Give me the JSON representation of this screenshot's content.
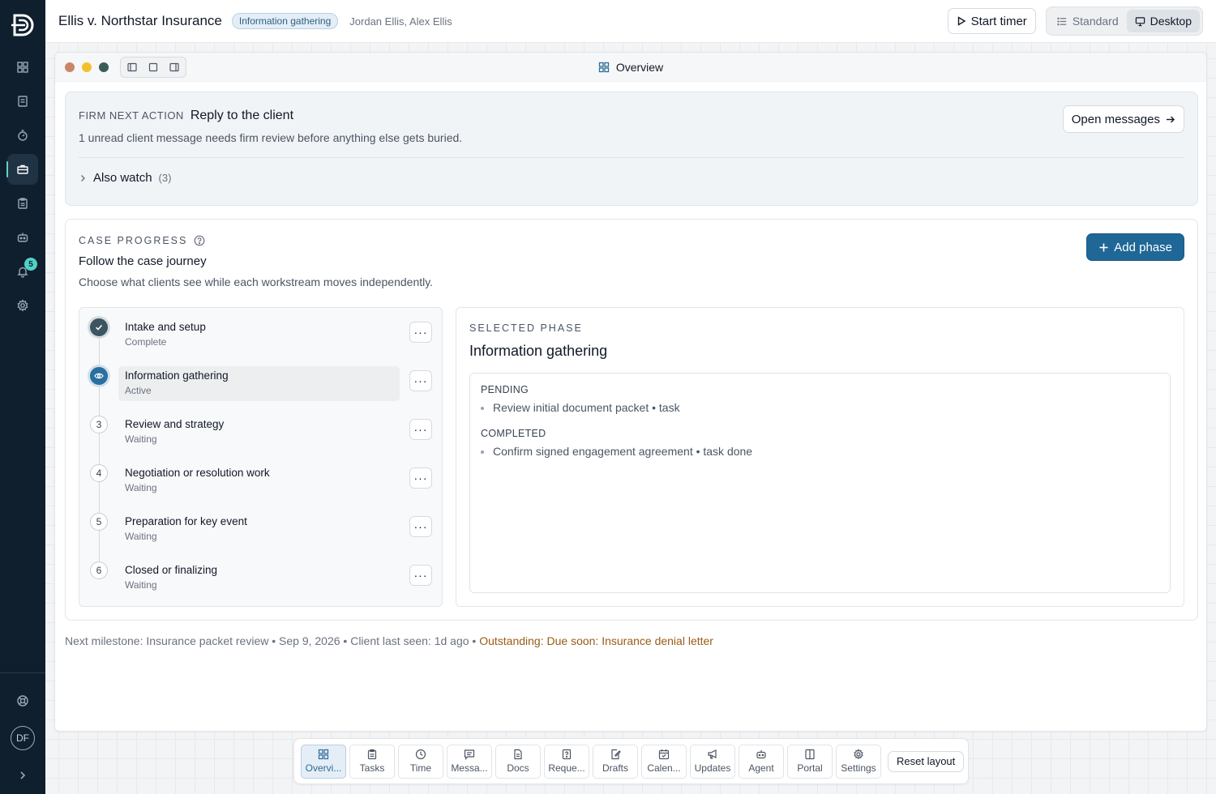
{
  "topbar": {
    "case_title": "Ellis v. Northstar Insurance",
    "phase_pill": "Information gathering",
    "clients": "Jordan Ellis, Alex Ellis",
    "start_timer": "Start timer",
    "view_standard": "Standard",
    "view_desktop": "Desktop"
  },
  "rail": {
    "notifications_badge": "5",
    "avatar_initials": "DF"
  },
  "window": {
    "title": "Overview",
    "dot_colors": [
      "#c9866a",
      "#f3c02d",
      "#3b5d58"
    ]
  },
  "next_action": {
    "eyebrow": "Firm next action",
    "headline": "Reply to the client",
    "description": "1 unread client message needs firm review before anything else gets buried.",
    "open_button": "Open messages",
    "also_watch_label": "Also watch",
    "also_watch_count": "(3)"
  },
  "progress": {
    "eyebrow": "Case progress",
    "title": "Follow the case journey",
    "subtitle": "Choose what clients see while each workstream moves independently.",
    "add_phase": "Add phase",
    "phases": [
      {
        "marker": "",
        "name": "Intake and setup",
        "status": "Complete"
      },
      {
        "marker": "",
        "name": "Information gathering",
        "status": "Active"
      },
      {
        "marker": "3",
        "name": "Review and strategy",
        "status": "Waiting"
      },
      {
        "marker": "4",
        "name": "Negotiation or resolution work",
        "status": "Waiting"
      },
      {
        "marker": "5",
        "name": "Preparation for key event",
        "status": "Waiting"
      },
      {
        "marker": "6",
        "name": "Closed or finalizing",
        "status": "Waiting"
      }
    ],
    "more_label": "···"
  },
  "selected_phase": {
    "eyebrow": "Selected phase",
    "title": "Information gathering",
    "pending_label": "PENDING",
    "pending_items": [
      "Review initial document packet • task"
    ],
    "completed_label": "COMPLETED",
    "completed_items": [
      "Confirm signed engagement agreement • task done"
    ]
  },
  "footer": {
    "milestone": "Next milestone: Insurance packet review • Sep 9, 2026 • Client last seen: 1d ago • ",
    "outstanding": "Outstanding: Due soon: Insurance denial letter"
  },
  "dock": {
    "tabs": [
      "Overvi...",
      "Tasks",
      "Time",
      "Messa...",
      "Docs",
      "Reque...",
      "Drafts",
      "Calen...",
      "Updates",
      "Agent",
      "Portal",
      "Settings"
    ],
    "reset": "Reset layout"
  }
}
